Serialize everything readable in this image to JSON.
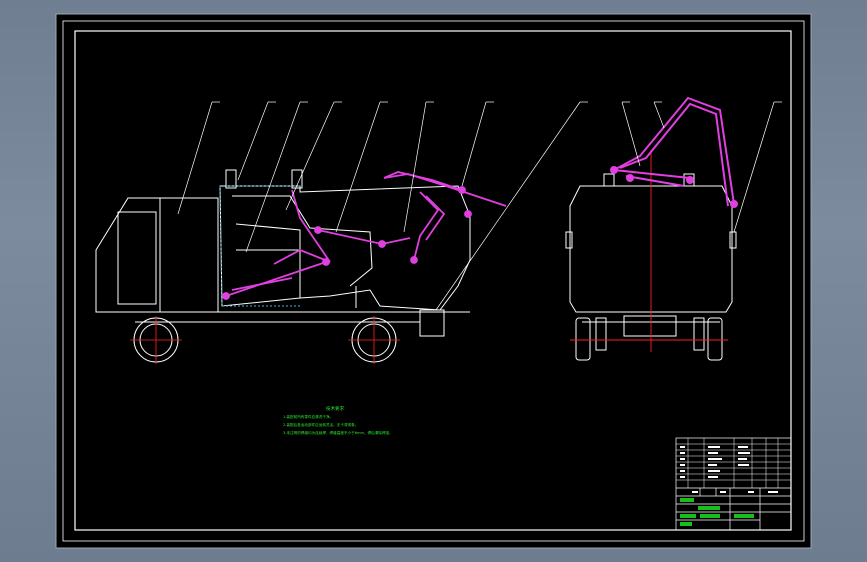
{
  "colors": {
    "viewport_bg": "#7a8a9c",
    "sheet_bg": "#000000",
    "outline": "#ffffff",
    "mechanism": "#e13fe0",
    "centerline": "#ff2020",
    "hatch": "#3fb8d8",
    "notes": "#2ee82e",
    "table_green": "#18c018"
  },
  "drawing": {
    "side_view": {
      "components": [
        "cab-body",
        "cab-window",
        "refuse-bin",
        "hopper",
        "lift-arm",
        "hydraulic-cylinder",
        "front-wheel",
        "rear-wheel",
        "ejector-panel",
        "tailgate"
      ],
      "leader_count": 7
    },
    "rear_view": {
      "components": [
        "bin-body",
        "tipper-arm",
        "wheels",
        "centerline"
      ],
      "leader_count": 4
    },
    "notes": {
      "title": "技术要求",
      "lines": [
        "1.装配前所有零件应清洗干净。",
        "2.装配后各运动部件应运转灵活，无卡滞现象。",
        "3.未注明的焊缝均为连续焊，焊缝高度不小于6mm，焊后清除焊渣。"
      ]
    },
    "title_block": {
      "rows": 8,
      "highlight_cells": 6
    }
  }
}
